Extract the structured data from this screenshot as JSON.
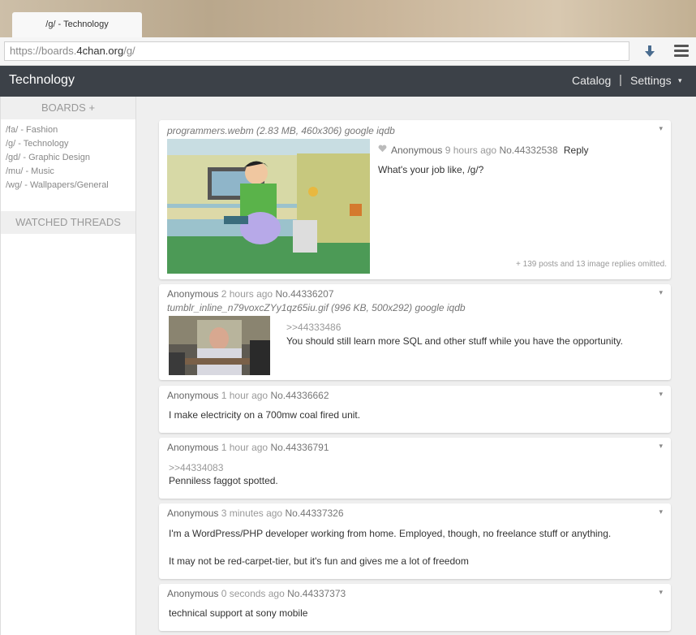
{
  "browser": {
    "tab_title": "/g/ - Technology",
    "url_prefix": "https://boards.",
    "url_domain": "4chan.org",
    "url_suffix": "/g/"
  },
  "header": {
    "board_title": "Technology",
    "catalog": "Catalog",
    "separator": "|",
    "settings": "Settings",
    "settings_caret": "▾"
  },
  "sidebar": {
    "boards_heading": "BOARDS +",
    "boards": [
      "/fa/ - Fashion",
      "/g/ - Technology",
      "/gd/ - Graphic Design",
      "/mu/ - Music",
      "/wg/ - Wallpapers/General"
    ],
    "watched_heading": "WATCHED THREADS"
  },
  "op": {
    "fileinfo": "programmers.webm (2.83 MB, 460x306) google iqdb",
    "name": "Anonymous",
    "time": "9 hours ago",
    "no": "No.44332538",
    "reply": "Reply",
    "text": "What's your job like, /g/?",
    "omitted": "+ 139 posts and 13 image replies omitted."
  },
  "replies": [
    {
      "name": "Anonymous",
      "time": "2 hours ago",
      "no": "No.44336207",
      "fileinfo": "tumblr_inline_n79voxcZYy1qz65iu.gif (996 KB, 500x292) google iqdb",
      "quote": ">>44333486",
      "text": "You should still learn more SQL and other stuff while you have the opportunity."
    },
    {
      "name": "Anonymous",
      "time": "1 hour ago",
      "no": "No.44336662",
      "text": "I make electricity on a 700mw coal fired unit."
    },
    {
      "name": "Anonymous",
      "time": "1 hour ago",
      "no": "No.44336791",
      "quote": ">>44334083",
      "text": "Penniless faggot spotted."
    },
    {
      "name": "Anonymous",
      "time": "3 minutes ago",
      "no": "No.44337326",
      "text": "I'm a WordPress/PHP developer working from home. Employed, though, no freelance stuff or anything.",
      "text2": "It may not be red-carpet-tier, but it's fun and gives me a lot of freedom"
    },
    {
      "name": "Anonymous",
      "time": "0 seconds ago",
      "no": "No.44337373",
      "text": "technical support at sony mobile"
    }
  ],
  "option_glyph": "▾"
}
